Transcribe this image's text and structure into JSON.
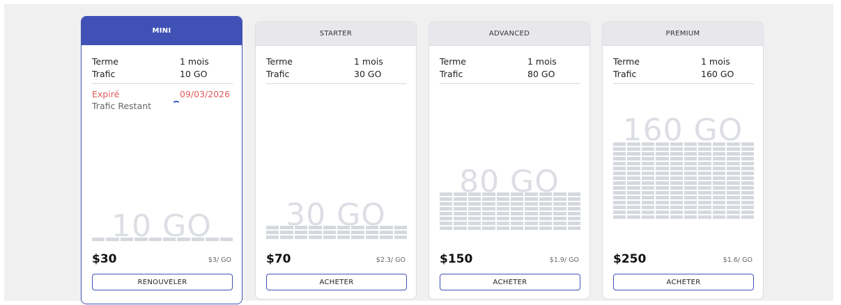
{
  "term_label": "Terme",
  "traffic_label": "Trafic",
  "plans": [
    {
      "name": "MINI",
      "term": "1 mois",
      "traffic": "10 GO",
      "price": "$30",
      "per_unit": "$3/ GO",
      "button": "RENOUVELER",
      "expired_label": "Expiré",
      "expired_date": "09/03/2026",
      "remaining_label": "Trafic Restant",
      "grid_rows": 1,
      "active": true
    },
    {
      "name": "STARTER",
      "term": "1 mois",
      "traffic": "30 GO",
      "price": "$70",
      "per_unit": "$2.3/ GO",
      "button": "ACHETER",
      "grid_rows": 3
    },
    {
      "name": "ADVANCED",
      "term": "1 mois",
      "traffic": "80 GO",
      "price": "$150",
      "per_unit": "$1.9/ GO",
      "button": "ACHETER",
      "grid_rows": 8
    },
    {
      "name": "PREMIUM",
      "term": "1 mois",
      "traffic": "160 GO",
      "price": "$250",
      "per_unit": "$1.6/ GO",
      "button": "ACHETER",
      "grid_rows": 16
    }
  ],
  "colors": {
    "accent": "#3f51b5",
    "expired": "#e05a5a"
  }
}
